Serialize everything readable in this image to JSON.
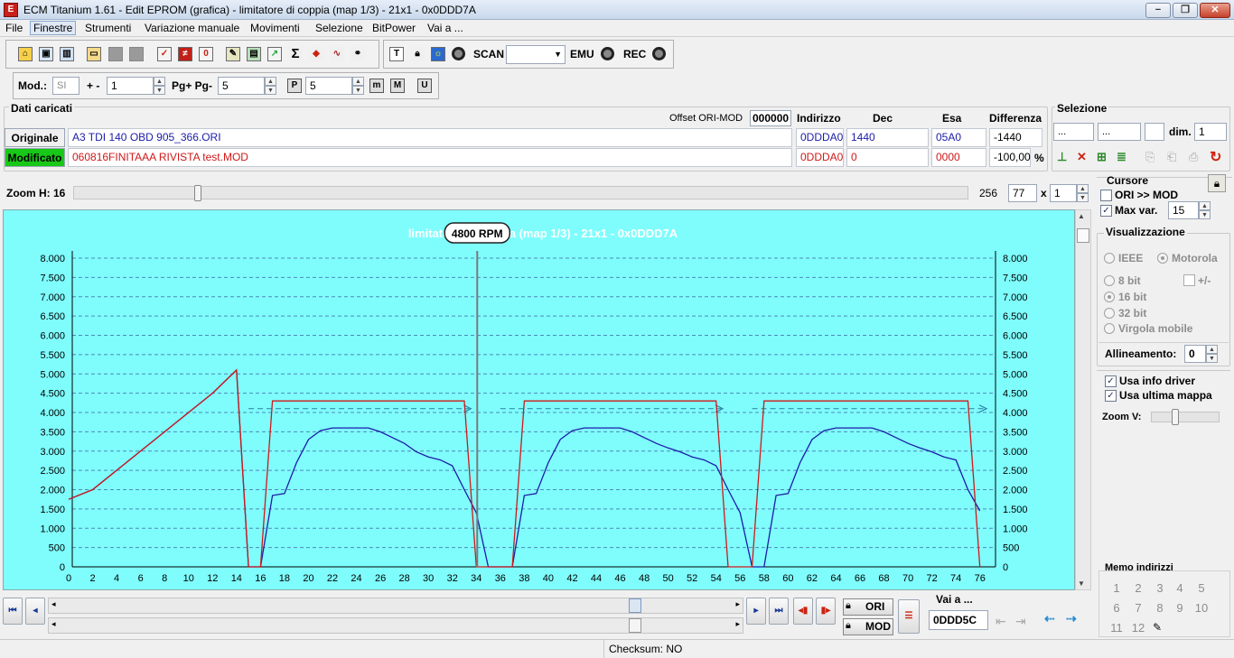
{
  "window": {
    "title": "ECM Titanium 1.61 - Edit EPROM (grafica) - limitatore di coppia (map 1/3) - 21x1 - 0x0DDD7A",
    "icon": "ecm-app-icon",
    "min_btn": "−",
    "max_btn": "❐",
    "close_btn": "✕"
  },
  "menu": {
    "items": [
      "File",
      "Finestre",
      "Strumenti",
      "Variazione manuale",
      "Movimenti",
      "Selezione",
      "BitPower",
      "Vai a ..."
    ]
  },
  "toolbar": {
    "scan_label": "SCAN",
    "scan_value": "",
    "emu_label": "EMU",
    "rec_label": "REC",
    "mod_label": "Mod.:",
    "mod_value": "SI",
    "plusminus_label": "+ -",
    "plusminus_value": "1",
    "pg_label": "Pg+ Pg-",
    "pg_value": "5",
    "p_btn": "P",
    "p_value": "5",
    "m_btn": "m",
    "M_btn": "M",
    "U_btn": "U"
  },
  "dati": {
    "title": "Dati caricati",
    "offset_label": "Offset ORI-MOD",
    "offset_value": "000000",
    "col_indirizzo": "Indirizzo",
    "col_dec": "Dec",
    "col_esa": "Esa",
    "col_diff": "Differenza",
    "ori_label": "Originale",
    "ori_file": "A3 TDI 140 OBD 905_366.ORI",
    "ori_addr": "0DDDA0",
    "ori_dec": "1440",
    "ori_esa": "05A0",
    "ori_diff": "-1440",
    "mod_label": "Modificato",
    "mod_file": "060816FINITAAA RIVISTA test.MOD",
    "mod_addr": "0DDDA0",
    "mod_dec": "0",
    "mod_esa": "0000",
    "mod_diff": "-100,00",
    "pct": "%"
  },
  "selezione": {
    "title": "Selezione",
    "f1": "...",
    "f2": "...",
    "f3": "",
    "dim_label": "dim.",
    "dim_value": "1"
  },
  "zoom": {
    "label": "Zoom H: 16",
    "max": "256",
    "value": "77",
    "x": "x",
    "mult": "1",
    "slider_level": 0.135
  },
  "cursore": {
    "title": "Cursore",
    "ori_mod_label": "ORI >> MOD",
    "ori_mod_checked": false,
    "maxvar_label": "Max var.",
    "maxvar_checked": true,
    "maxvar_value": "15"
  },
  "visual": {
    "title": "Visualizzazione",
    "ieee": "IEEE",
    "motorola": "Motorola",
    "bit8": "8 bit",
    "plusminus": "+/-",
    "bit16": "16 bit",
    "bit32": "32 bit",
    "virgola": "Virgola mobile",
    "allineamento_label": "Allineamento:",
    "allineamento_value": "0",
    "usa_info": "Usa info driver",
    "usa_ultima": "Usa ultima mappa",
    "zoomv_label": "Zoom V:"
  },
  "memo": {
    "title": "Memo indirizzi",
    "nums": [
      "1",
      "2",
      "3",
      "4",
      "5",
      "6",
      "7",
      "8",
      "9",
      "10",
      "11",
      "12"
    ]
  },
  "bottom": {
    "ori_btn": "ORI",
    "mod_btn": "MOD",
    "vai_label": "Vai a ...",
    "vai_value": "0DDD5C"
  },
  "status": {
    "checksum": "Checksum: NO"
  },
  "colors": {
    "chart_bg": "#7ffdfd",
    "ori_line": "#1c1ca8",
    "mod_line": "#d01818",
    "arrow": "#2a7fa0"
  },
  "chart_data": {
    "type": "line",
    "title": "limitatore di coppia (map 1/3) - 21x1 - 0x0DDD7A",
    "cursor_label": "4800 RPM",
    "xlim": [
      0,
      77
    ],
    "ylim": [
      0,
      8000
    ],
    "x_ticks": [
      "0",
      "2",
      "4",
      "6",
      "8",
      "10",
      "12",
      "14",
      "16",
      "18",
      "20",
      "22",
      "24",
      "26",
      "28",
      "30",
      "32",
      "34",
      "36",
      "38",
      "40",
      "42",
      "44",
      "46",
      "48",
      "50",
      "52",
      "54",
      "56",
      "58",
      "60",
      "62",
      "64",
      "66",
      "68",
      "70",
      "72",
      "74",
      "76"
    ],
    "y_ticks": [
      "0",
      "500",
      "1.000",
      "1.500",
      "2.000",
      "2.500",
      "3.000",
      "3.500",
      "4.000",
      "4.500",
      "5.000",
      "5.500",
      "6.000",
      "6.500",
      "7.000",
      "7.500",
      "8.000"
    ],
    "cursor_x": 34,
    "grid": true,
    "series": [
      {
        "name": "",
        "color": "#1c1ca8",
        "x": [
          0,
          2,
          4,
          6,
          8,
          10,
          12,
          14,
          15,
          16,
          17,
          18,
          19,
          20,
          21,
          22,
          23,
          24,
          25,
          26,
          27,
          28,
          29,
          30,
          31,
          32,
          33,
          34,
          35,
          36,
          37,
          38,
          39,
          40,
          41,
          42,
          43,
          44,
          45,
          46,
          47,
          48,
          49,
          50,
          51,
          52,
          53,
          54,
          55,
          56,
          57,
          58,
          59,
          60,
          61,
          62,
          63,
          64,
          65,
          66,
          67,
          68,
          69,
          70,
          71,
          72,
          73,
          74,
          75,
          76
        ],
        "y": [
          1750,
          2000,
          2500,
          3000,
          3500,
          4000,
          4500,
          5100,
          0,
          0,
          1850,
          1900,
          2700,
          3300,
          3530,
          3600,
          3600,
          3600,
          3600,
          3500,
          3350,
          3200,
          2980,
          2850,
          2770,
          2620,
          2000,
          1400,
          0,
          0,
          0,
          1850,
          1900,
          2700,
          3300,
          3530,
          3600,
          3600,
          3600,
          3600,
          3500,
          3350,
          3200,
          3080,
          2980,
          2850,
          2770,
          2620,
          2000,
          1400,
          0,
          0,
          1850,
          1900,
          2700,
          3300,
          3530,
          3600,
          3600,
          3600,
          3600,
          3500,
          3350,
          3200,
          3080,
          2980,
          2850,
          2770,
          2000,
          1450
        ]
      },
      {
        "name": "",
        "color": "#d01818",
        "x": [
          0,
          2,
          4,
          6,
          8,
          10,
          12,
          14,
          15,
          16,
          17,
          33,
          34,
          35,
          36,
          37,
          38,
          53,
          54,
          55,
          56,
          57,
          58,
          74,
          75,
          76
        ],
        "y": [
          1750,
          2000,
          2500,
          3000,
          3500,
          4000,
          4500,
          5100,
          0,
          0,
          4300,
          4300,
          0,
          0,
          0,
          0,
          4300,
          4300,
          4300,
          0,
          0,
          0,
          4300,
          4300,
          4300,
          0
        ]
      }
    ]
  }
}
